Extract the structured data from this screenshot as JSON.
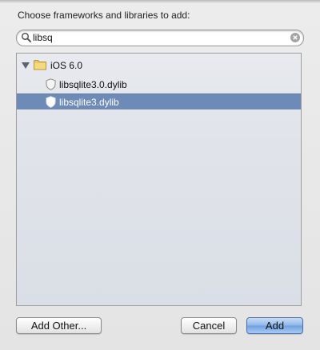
{
  "prompt": "Choose frameworks and libraries to add:",
  "search": {
    "value": "libsq"
  },
  "tree": {
    "group_label": "iOS 6.0",
    "items": [
      {
        "label": "libsqlite3.0.dylib",
        "selected": false
      },
      {
        "label": "libsqlite3.dylib",
        "selected": true
      }
    ]
  },
  "buttons": {
    "add_other": "Add Other...",
    "cancel": "Cancel",
    "add": "Add"
  },
  "colors": {
    "selection": "#6e8ab6",
    "default_button": "#8fb6e9"
  }
}
